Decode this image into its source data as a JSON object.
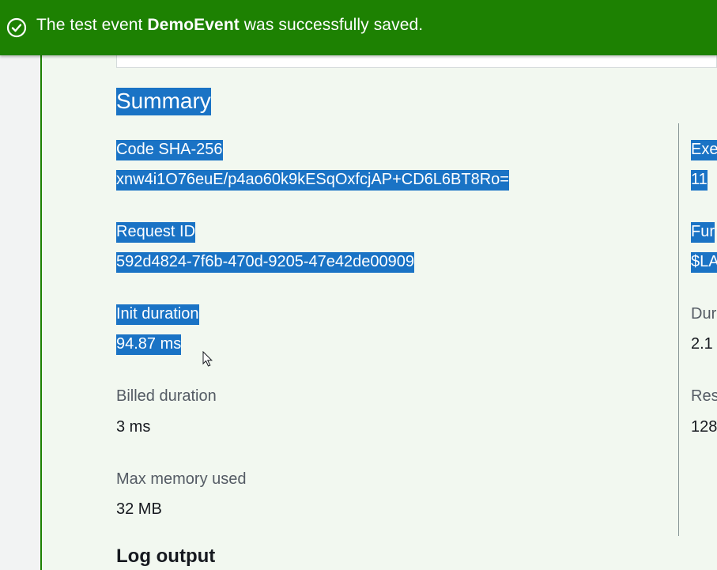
{
  "flash": {
    "prefix": "The test event ",
    "event_name": "DemoEvent",
    "suffix": " was successfully saved."
  },
  "json_preview": "}",
  "summary": {
    "heading": "Summary",
    "left_fields": [
      {
        "label": "Code SHA-256",
        "value": "xnw4i1O76euE/p4ao60k9kESqOxfcjAP+CD6L6BT8Ro="
      },
      {
        "label": "Request ID",
        "value": "592d4824-7f6b-470d-9205-47e42de00909"
      },
      {
        "label": "Init duration",
        "value": "94.87 ms"
      },
      {
        "label": "Billed duration",
        "value": "3 ms"
      },
      {
        "label": "Max memory used",
        "value": "32 MB"
      }
    ],
    "right_fields": [
      {
        "label": "Exe",
        "value": "11"
      },
      {
        "label": "Fur",
        "value": "$LA"
      },
      {
        "label": "Dur",
        "value": "2.1"
      },
      {
        "label": "Res",
        "value": "128"
      }
    ]
  },
  "log_output": {
    "heading": "Log output"
  },
  "colors": {
    "success": "#1d8102",
    "selection": "#1a73c5"
  }
}
